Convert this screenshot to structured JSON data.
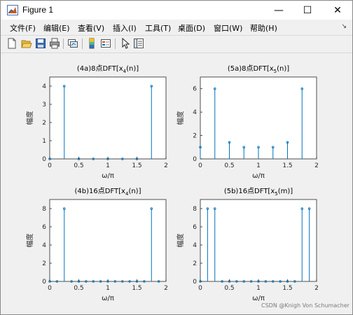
{
  "window": {
    "title": "Figure 1",
    "controls": {
      "minimize": "—",
      "maximize": "☐",
      "close": "✕"
    }
  },
  "menubar": {
    "items": [
      "文件(F)",
      "编辑(E)",
      "查看(V)",
      "插入(I)",
      "工具(T)",
      "桌面(D)",
      "窗口(W)",
      "帮助(H)"
    ]
  },
  "toolbar": {
    "buttons": [
      "new-figure-icon",
      "open-file-icon",
      "save-icon",
      "print-icon",
      "link-plot-icon",
      "colorbar-icon",
      "legend-icon",
      "edit-pointer-icon",
      "property-editor-icon"
    ]
  },
  "watermark": "CSDN @Knigh Von Schumacher",
  "colors": {
    "stem": "#0072bd",
    "axes_bg": "#ffffff",
    "figure_bg": "#f0f0f0"
  },
  "chart_data": [
    {
      "type": "bar",
      "title_main": "(4a)8点DFT[x",
      "title_sub": "4",
      "title_tail": "(n)]",
      "xlabel": "ω/π",
      "ylabel": "幅度",
      "xlim": [
        0,
        2
      ],
      "ylim": [
        0,
        4.5
      ],
      "xticks": [
        "0",
        "0.5",
        "1",
        "1.5",
        "2"
      ],
      "yticks": [
        "0",
        "1",
        "2",
        "3",
        "4"
      ],
      "x": [
        0,
        0.25,
        0.5,
        0.75,
        1,
        1.25,
        1.5,
        1.75
      ],
      "values": [
        0,
        4,
        0,
        0,
        0,
        0,
        0,
        4
      ]
    },
    {
      "type": "bar",
      "title_main": "(5a)8点DFT[x",
      "title_sub": "5",
      "title_tail": "(n)]",
      "xlabel": "ω/π",
      "ylabel": "幅度",
      "xlim": [
        0,
        2
      ],
      "ylim": [
        0,
        7
      ],
      "xticks": [
        "0",
        "0.5",
        "1",
        "1.5",
        "2"
      ],
      "yticks": [
        "0",
        "2",
        "4",
        "6"
      ],
      "x": [
        0,
        0.25,
        0.5,
        0.75,
        1,
        1.25,
        1.5,
        1.75
      ],
      "values": [
        1,
        6,
        1.41,
        1,
        1,
        1,
        1.41,
        6
      ]
    },
    {
      "type": "bar",
      "title_main": "(4b)16点DFT[x",
      "title_sub": "4",
      "title_tail": "(n)]",
      "xlabel": "ω/π",
      "ylabel": "幅度",
      "xlim": [
        0,
        2
      ],
      "ylim": [
        0,
        9
      ],
      "xticks": [
        "0",
        "0.5",
        "1",
        "1.5",
        "2"
      ],
      "yticks": [
        "0",
        "2",
        "4",
        "6",
        "8"
      ],
      "x": [
        0,
        0.125,
        0.25,
        0.375,
        0.5,
        0.625,
        0.75,
        0.875,
        1,
        1.125,
        1.25,
        1.375,
        1.5,
        1.625,
        1.75,
        1.875
      ],
      "values": [
        0,
        0,
        8,
        0,
        0,
        0,
        0,
        0,
        0,
        0,
        0,
        0,
        0,
        0,
        8,
        0
      ]
    },
    {
      "type": "bar",
      "title_main": "(5b)16点DFT[x",
      "title_sub": "5",
      "title_tail": "(m)]",
      "xlabel": "ω/π",
      "ylabel": "幅度",
      "xlim": [
        0,
        2
      ],
      "ylim": [
        0,
        9
      ],
      "xticks": [
        "0",
        "0.5",
        "1",
        "1.5",
        "2"
      ],
      "yticks": [
        "0",
        "2",
        "4",
        "6",
        "8"
      ],
      "x": [
        0,
        0.125,
        0.25,
        0.375,
        0.5,
        0.625,
        0.75,
        0.875,
        1,
        1.125,
        1.25,
        1.375,
        1.5,
        1.625,
        1.75,
        1.875
      ],
      "values": [
        0,
        8,
        8,
        0,
        0,
        0,
        0,
        0,
        0,
        0,
        0,
        0,
        0,
        0,
        8,
        8
      ]
    }
  ]
}
